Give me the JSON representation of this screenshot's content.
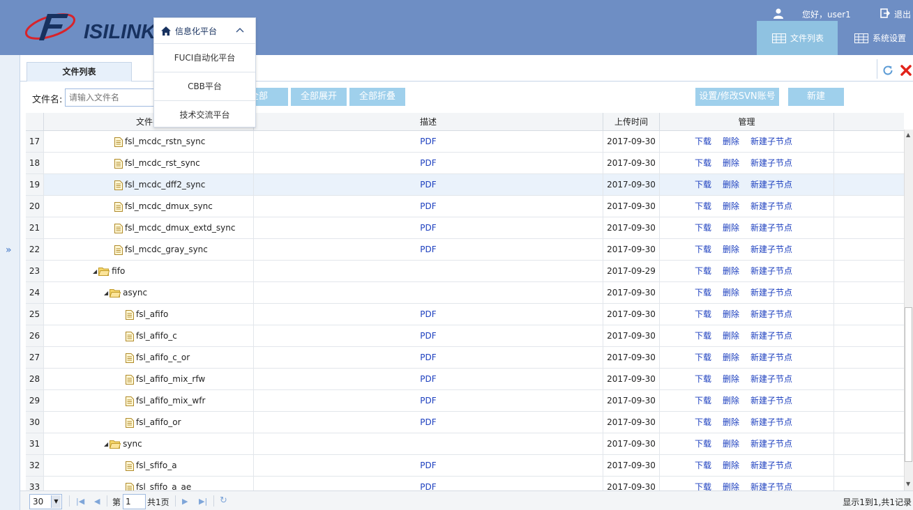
{
  "header": {
    "logo_text": "ISILINK",
    "greeting": "您好，user1",
    "logout": "退出",
    "nav": [
      {
        "label": "文件列表",
        "active": true
      },
      {
        "label": "系统设置",
        "active": false
      }
    ]
  },
  "platform_menu": {
    "current": "信息化平台",
    "items": [
      "FUCI自动化平台",
      "CBB平台",
      "技术交流平台"
    ]
  },
  "tabs": [
    {
      "label": "文件列表"
    }
  ],
  "toolbar": {
    "filename_label": "文件名:",
    "filename_placeholder": "请输入文件名",
    "buttons": {
      "all": "全部",
      "expand_all": "全部展开",
      "collapse_all": "全部折叠",
      "svn": "设置/修改SVN账号",
      "new": "新建"
    }
  },
  "grid": {
    "columns": [
      "文件名",
      "描述",
      "上传时间",
      "管理"
    ],
    "actions": {
      "download": "下载",
      "delete": "删除",
      "new_child": "新建子节点"
    },
    "rows": [
      {
        "num": "17",
        "name": "fsl_mcdc_rstn_sync",
        "type": "file",
        "level": 1,
        "desc": "PDF",
        "date": "2017-09-30"
      },
      {
        "num": "18",
        "name": "fsl_mcdc_rst_sync",
        "type": "file",
        "level": 1,
        "desc": "PDF",
        "date": "2017-09-30"
      },
      {
        "num": "19",
        "name": "fsl_mcdc_dff2_sync",
        "type": "file",
        "level": 1,
        "desc": "PDF",
        "date": "2017-09-30",
        "highlight": true
      },
      {
        "num": "20",
        "name": "fsl_mcdc_dmux_sync",
        "type": "file",
        "level": 1,
        "desc": "PDF",
        "date": "2017-09-30"
      },
      {
        "num": "21",
        "name": "fsl_mcdc_dmux_extd_sync",
        "type": "file",
        "level": 1,
        "desc": "PDF",
        "date": "2017-09-30"
      },
      {
        "num": "22",
        "name": "fsl_mcdc_gray_sync",
        "type": "file",
        "level": 1,
        "desc": "PDF",
        "date": "2017-09-30"
      },
      {
        "num": "23",
        "name": "fifo",
        "type": "folder",
        "level": 0,
        "desc": "",
        "date": "2017-09-29"
      },
      {
        "num": "24",
        "name": "async",
        "type": "folder",
        "level": 1,
        "desc": "",
        "date": "2017-09-30"
      },
      {
        "num": "25",
        "name": "fsl_afifo",
        "type": "file",
        "level": 2,
        "desc": "PDF",
        "date": "2017-09-30"
      },
      {
        "num": "26",
        "name": "fsl_afifo_c",
        "type": "file",
        "level": 2,
        "desc": "PDF",
        "date": "2017-09-30"
      },
      {
        "num": "27",
        "name": "fsl_afifo_c_or",
        "type": "file",
        "level": 2,
        "desc": "PDF",
        "date": "2017-09-30"
      },
      {
        "num": "28",
        "name": "fsl_afifo_mix_rfw",
        "type": "file",
        "level": 2,
        "desc": "PDF",
        "date": "2017-09-30"
      },
      {
        "num": "29",
        "name": "fsl_afifo_mix_wfr",
        "type": "file",
        "level": 2,
        "desc": "PDF",
        "date": "2017-09-30"
      },
      {
        "num": "30",
        "name": "fsl_afifo_or",
        "type": "file",
        "level": 2,
        "desc": "PDF",
        "date": "2017-09-30"
      },
      {
        "num": "31",
        "name": "sync",
        "type": "folder",
        "level": 1,
        "desc": "",
        "date": "2017-09-30"
      },
      {
        "num": "32",
        "name": "fsl_sfifo_a",
        "type": "file",
        "level": 2,
        "desc": "PDF",
        "date": "2017-09-30"
      },
      {
        "num": "33",
        "name": "fsl_sfifo_a_ae",
        "type": "file",
        "level": 2,
        "desc": "PDF",
        "date": "2017-09-30"
      }
    ]
  },
  "pager": {
    "page_size": "30",
    "page_prefix": "第",
    "page_value": "1",
    "page_suffix": "共1页",
    "info": "显示1到1,共1记录"
  },
  "colors": {
    "header_bg": "#6e8ec4",
    "nav_active": "#8fc2e1",
    "button_bg": "#9fd0ec",
    "link": "#1c3fbf",
    "row_highlight": "#eaf2fb"
  }
}
